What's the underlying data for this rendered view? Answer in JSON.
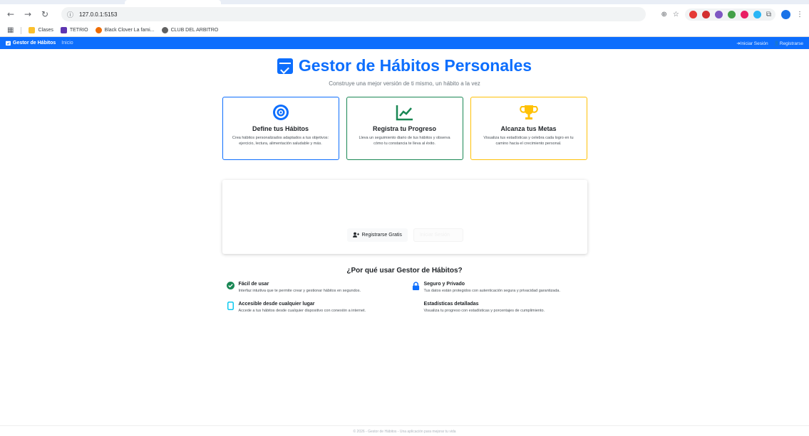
{
  "browser": {
    "url": "127.0.0.1:5153",
    "bookmarks": [
      "Clases",
      "TETRIO",
      "Black Clover La fami...",
      "CLUB DEL ARBITRO"
    ]
  },
  "navbar": {
    "brand": "Gestor de Hábitos",
    "home": "Inicio",
    "login": "Iniciar Sesión",
    "register": "Registrarse"
  },
  "hero": {
    "title": "Gestor de Hábitos Personales",
    "subtitle": "Construye una mejor versión de ti mismo, un hábito a la vez"
  },
  "cards": [
    {
      "title": "Define tus Hábitos",
      "text": "Crea hábitos personalizados adaptados a tus objetivos: ejercicio, lectura, alimentación saludable y más.",
      "icon": "target-icon",
      "color": "#0d6efd"
    },
    {
      "title": "Registra tu Progreso",
      "text": "Lleva un seguimiento diario de tus hábitos y observa cómo tu constancia te lleva al éxito.",
      "icon": "chart-line-icon",
      "color": "#198754"
    },
    {
      "title": "Alcanza tus Metas",
      "text": "Visualiza tus estadísticas y celebra cada logro en tu camino hacia el crecimiento personal.",
      "icon": "trophy-icon",
      "color": "#ffc107"
    }
  ],
  "cta": {
    "register_label": "Registrarse Gratis",
    "login_label": "Iniciar Sesión"
  },
  "why": {
    "title": "¿Por qué usar Gestor de Hábitos?",
    "items": [
      {
        "title": "Fácil de usar",
        "text": "Interfaz intuitiva que te permite crear y gestionar hábitos en segundos."
      },
      {
        "title": "Seguro y Privado",
        "text": "Tus datos están protegidos con autenticación segura y privacidad garantizada."
      },
      {
        "title": "Accesible desde cualquier lugar",
        "text": "Accede a tus hábitos desde cualquier dispositivo con conexión a internet."
      },
      {
        "title": "Estadísticas detalladas",
        "text": "Visualiza tu progreso con estadísticas y porcentajes de cumplimiento."
      }
    ]
  },
  "footer": "© 2026 - Gestor de Hábitos - Una aplicación para mejorar tu vida"
}
